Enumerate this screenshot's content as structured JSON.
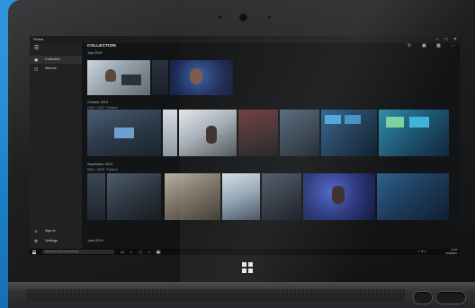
{
  "window": {
    "app_title": "Photos",
    "controls": [
      "–",
      "□",
      "✕"
    ]
  },
  "sidebar": {
    "menu_icon": "hamburger-icon",
    "items": [
      {
        "label": "Collection",
        "icon": "photos-icon",
        "active": true
      },
      {
        "label": "Albums",
        "icon": "album-icon",
        "active": false
      }
    ],
    "bottom_items": [
      {
        "label": "Sign in",
        "icon": "user-icon"
      },
      {
        "label": "Settings",
        "icon": "gear-icon"
      }
    ]
  },
  "header": {
    "title": "COLLECTION",
    "tools": [
      "refresh-icon",
      "select-icon",
      "slideshow-icon",
      "more-icon"
    ]
  },
  "groups": [
    {
      "title": "July 2015",
      "subtitle": ""
    },
    {
      "title": "October 2014",
      "subtitle": "10/15 - 10/23 · Portland"
    },
    {
      "title": "September 2014",
      "subtitle": "09/04 - 09/09 · Portland"
    },
    {
      "title": "June 2014",
      "subtitle": ""
    }
  ],
  "taskbar": {
    "search_placeholder": "Search the web and Windows",
    "clock_time": "11:33",
    "clock_date": "10/30/2015",
    "icons": [
      "task-view-icon",
      "edge-icon",
      "explorer-icon",
      "store-icon",
      "photos-icon"
    ]
  },
  "colors": {
    "background_blue": "#1d84cf",
    "accent": "#2d7fd3",
    "sidebar": "#202122",
    "content": "#131415"
  }
}
